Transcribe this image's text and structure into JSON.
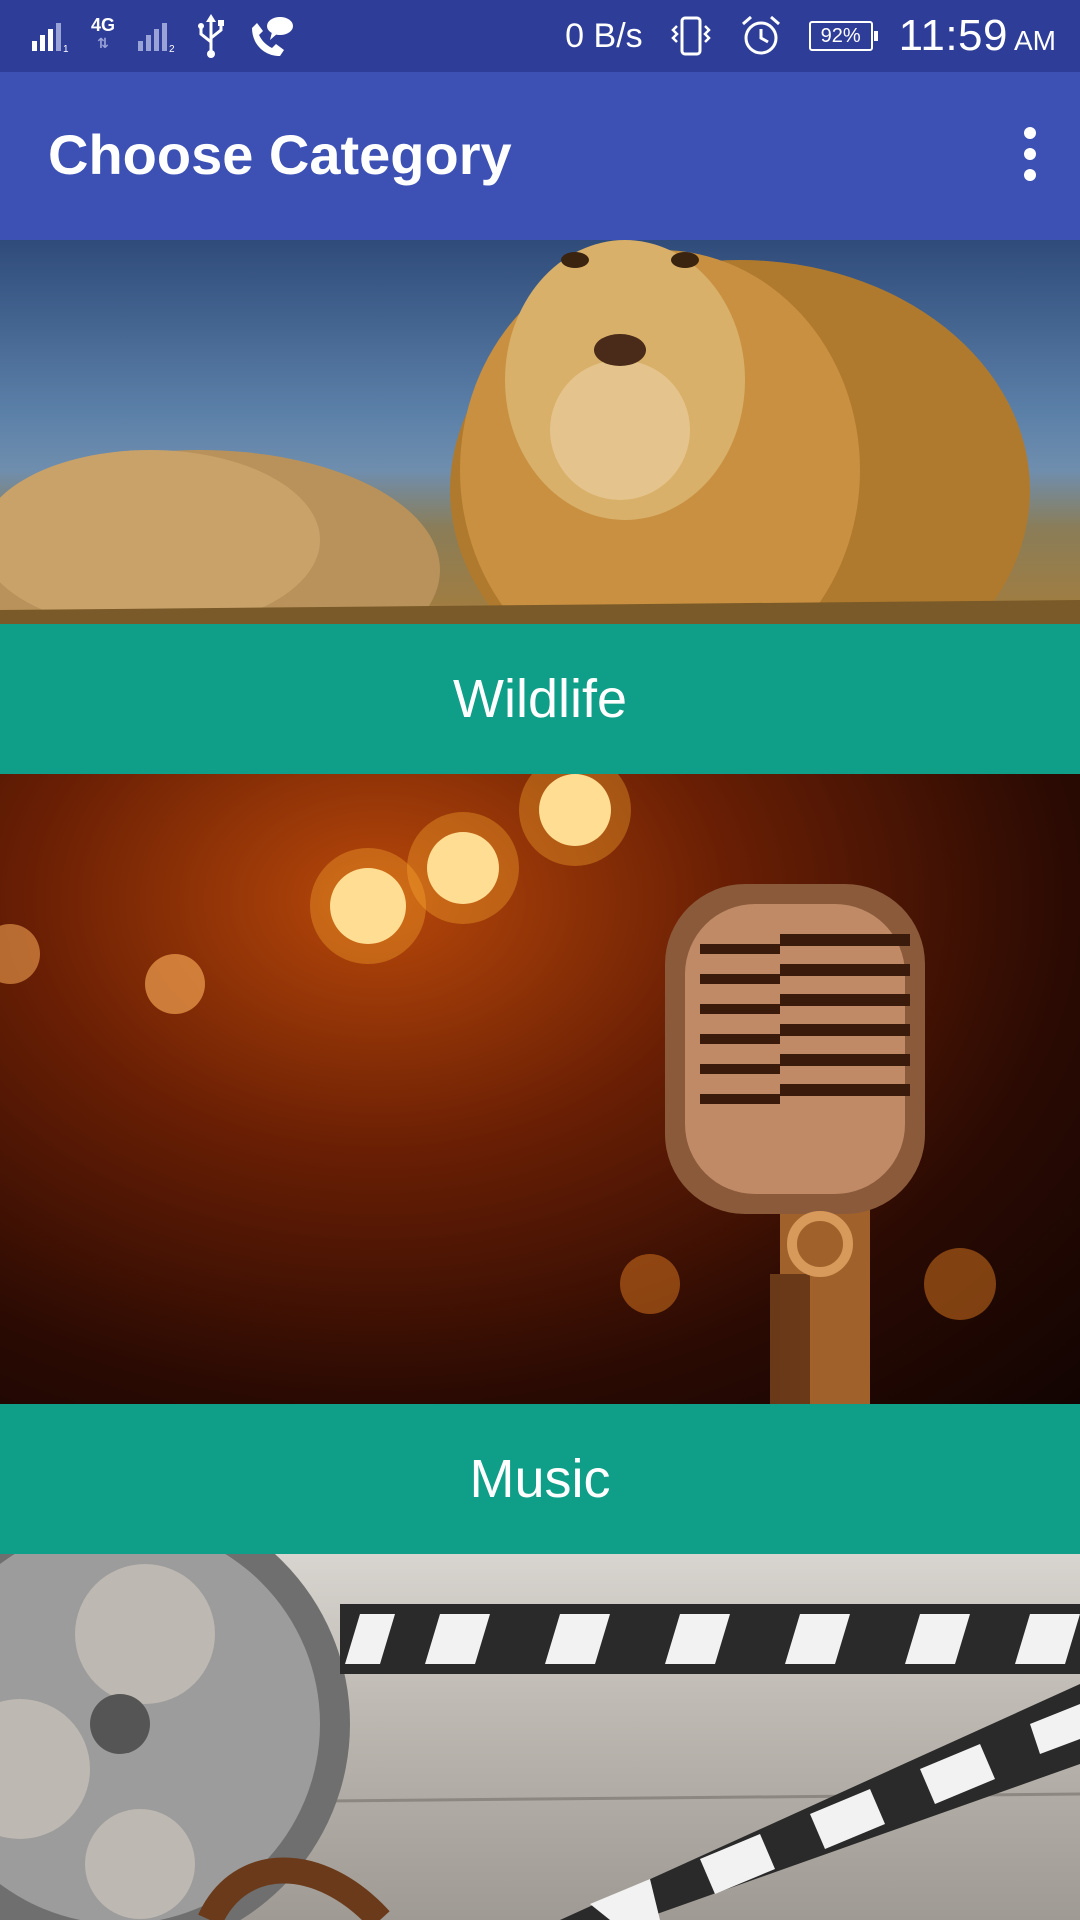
{
  "status_bar": {
    "network_type": "4G",
    "network_speed": "0 B/s",
    "battery": "92%",
    "time": "11:59",
    "ampm": "AM"
  },
  "app_bar": {
    "title": "Choose Category",
    "overflow_icon": "more-vert-icon"
  },
  "categories": [
    {
      "label": "Wildlife",
      "image": "lion-photo"
    },
    {
      "label": "Music",
      "image": "microphone-photo"
    },
    {
      "label": "",
      "image": "film-reel-clapperboard-photo"
    }
  ],
  "colors": {
    "status_bar": "#2E3D98",
    "app_bar": "#3D51B5",
    "label_bar": "#0F9E88"
  }
}
